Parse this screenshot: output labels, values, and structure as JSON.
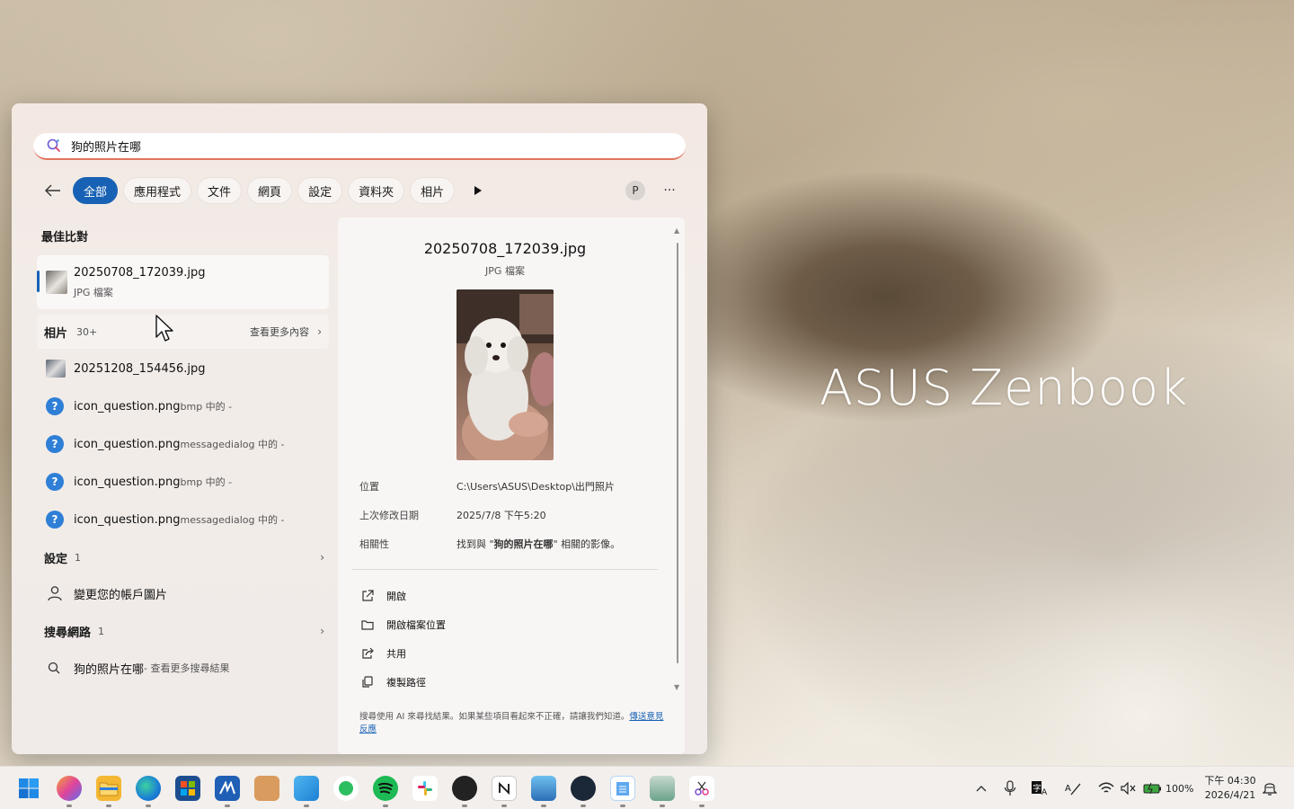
{
  "desktop": {
    "brand": "ASUS Zenbook"
  },
  "search": {
    "query": "狗的照片在哪"
  },
  "filters": [
    "全部",
    "應用程式",
    "文件",
    "網頁",
    "設定",
    "資料夾",
    "相片"
  ],
  "account_initial": "P",
  "more_label": "···",
  "best_match": {
    "title": "最佳比對",
    "name": "20250708_172039.jpg",
    "type": "JPG 檔案"
  },
  "photos_group": {
    "title": "相片",
    "count": "30+",
    "see_more": "查看更多內容",
    "items": [
      {
        "name": "20251208_154456.jpg",
        "sub": ""
      },
      {
        "name": "icon_question.png",
        "sub": "bmp 中的 -"
      },
      {
        "name": "icon_question.png",
        "sub": "messagedialog 中的 -"
      },
      {
        "name": "icon_question.png",
        "sub": "bmp 中的 -"
      },
      {
        "name": "icon_question.png",
        "sub": "messagedialog 中的 -"
      }
    ]
  },
  "settings_group": {
    "title": "設定",
    "count": "1",
    "item": "變更您的帳戶圖片"
  },
  "web_group": {
    "title": "搜尋網路",
    "count": "1",
    "item": "狗的照片在哪",
    "item_sub": " - 查看更多搜尋結果"
  },
  "detail": {
    "title": "20250708_172039.jpg",
    "type": "JPG 檔案",
    "location_label": "位置",
    "location_value": "C:\\Users\\ASUS\\Desktop\\出門照片",
    "modified_label": "上次修改日期",
    "modified_value": "2025/7/8 下午5:20",
    "relevance_label": "相關性",
    "relevance_prefix": "找到與 \"",
    "relevance_query": "狗的照片在哪",
    "relevance_suffix": "\" 相關的影像。",
    "actions": [
      "開啟",
      "開啟檔案位置",
      "共用",
      "複製路徑"
    ],
    "footnote_text": "搜尋使用 AI 來尋找結果。如果某些項目看起來不正確，請讓我們知道。",
    "footnote_link": "傳送意見反應"
  },
  "taskbar": {
    "battery": "100%",
    "time": "下午 04:30",
    "date": "2026/4/21"
  }
}
